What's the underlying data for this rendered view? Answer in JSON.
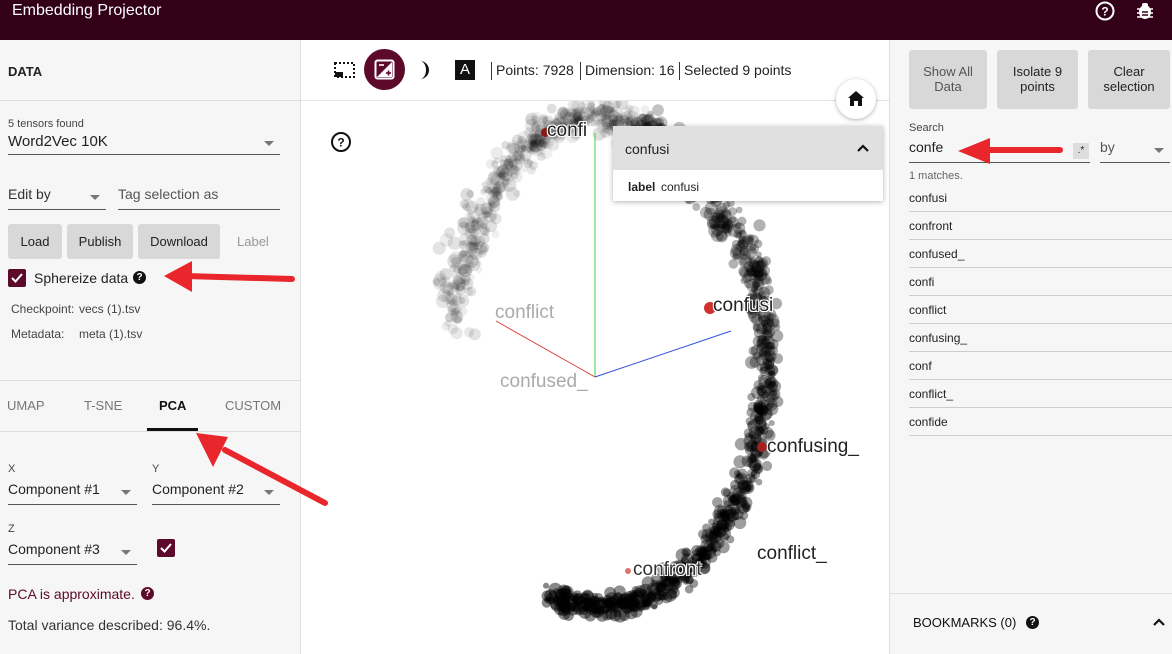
{
  "app": {
    "title": "Embedding Projector"
  },
  "header_icons": [
    "help-icon",
    "bug-icon"
  ],
  "data_panel": {
    "title": "DATA",
    "tensors_found": "5 tensors found",
    "tensor_selected": "Word2Vec 10K",
    "edit_by": "Edit by",
    "tag_selection_placeholder": "Tag selection as",
    "buttons": {
      "load": "Load",
      "publish": "Publish",
      "download": "Download",
      "label": "Label"
    },
    "sphereize": {
      "label": "Sphereize data",
      "checked": true
    },
    "checkpoint_label": "Checkpoint:",
    "checkpoint_value": "vecs (1).tsv",
    "metadata_label": "Metadata:",
    "metadata_value": "meta (1).tsv"
  },
  "projection_tabs": [
    {
      "label": "UMAP",
      "active": false
    },
    {
      "label": "T-SNE",
      "active": false
    },
    {
      "label": "PCA",
      "active": true
    },
    {
      "label": "CUSTOM",
      "active": false
    }
  ],
  "pca": {
    "x_label": "X",
    "x_value": "Component #1",
    "y_label": "Y",
    "y_value": "Component #2",
    "z_label": "Z",
    "z_value": "Component #3",
    "z_enabled": true,
    "approx_note": "PCA is approximate.",
    "variance": "Total variance described: 96.4%."
  },
  "toolbar": {
    "icons": [
      "selection-icon",
      "night-mode-icon",
      "label-icon"
    ],
    "points": "Points: 7928",
    "dimension": "Dimension: 16",
    "selected": "Selected 9 points"
  },
  "plot": {
    "labels": [
      {
        "text": "confi",
        "faded": false
      },
      {
        "text": "confusi",
        "faded": false
      },
      {
        "text": "conflict",
        "faded": true
      },
      {
        "text": "confused_",
        "faded": true
      },
      {
        "text": "confusing_",
        "faded": false
      },
      {
        "text": "conflict_",
        "faded": false
      },
      {
        "text": "confront",
        "faded": false
      }
    ]
  },
  "inspector_card": {
    "title": "confusi",
    "field_key": "label",
    "field_value": "confusi"
  },
  "inspector": {
    "buttons": {
      "show_all": "Show All Data",
      "isolate": "Isolate 9 points",
      "clear": "Clear selection"
    },
    "search_label": "Search",
    "search_value": "confe",
    "regex_toggle": ".*",
    "by_label": "by",
    "matches": "1 matches.",
    "results": [
      "confusi",
      "confront",
      "confused_",
      "confi",
      "conflict",
      "confusing_",
      "conf",
      "conflict_",
      "confide"
    ],
    "bookmarks": "BOOKMARKS (0)"
  },
  "colors": {
    "brand": "#320018",
    "accent": "#5d0a2a",
    "annotation_arrow": "#e8262b"
  }
}
